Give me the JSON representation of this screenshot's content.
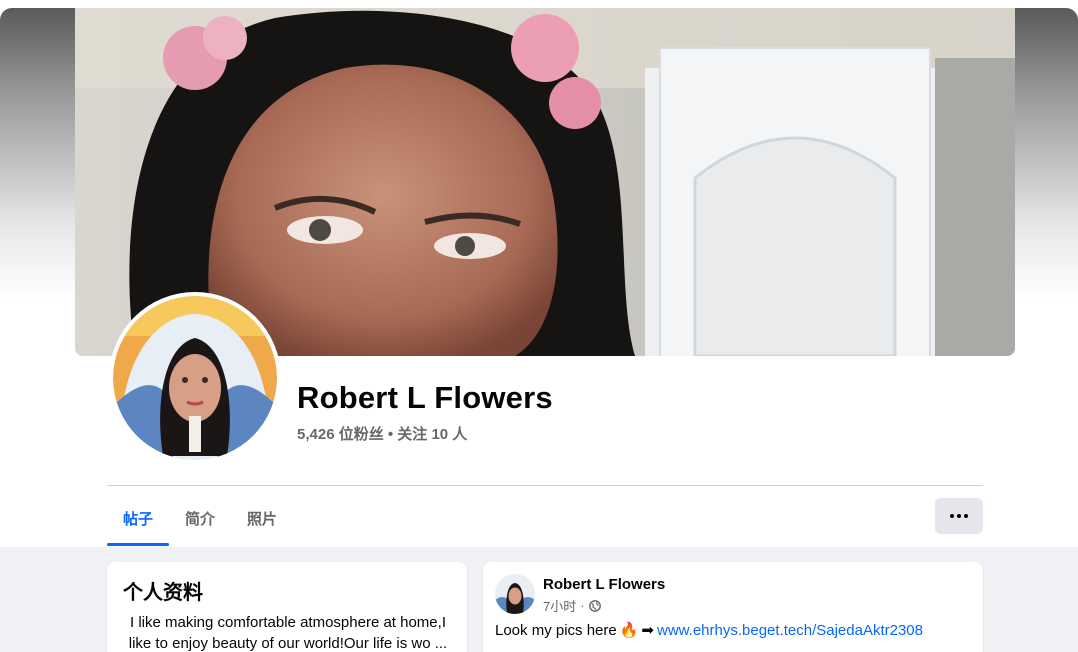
{
  "profile": {
    "name": "Robert L Flowers",
    "stats": "5,426 位粉丝 • 关注 10 人"
  },
  "tabs": [
    {
      "label": "帖子",
      "active": true
    },
    {
      "label": "简介",
      "active": false
    },
    {
      "label": "照片",
      "active": false
    }
  ],
  "more_button_icon": "more-horizontal-icon",
  "intro": {
    "title": "个人资料",
    "bio_line1": "I like making comfortable atmosphere at home,I",
    "bio_line2": "like to enjoy beauty of our world!Our life is wo ..."
  },
  "post": {
    "author": "Robert L Flowers",
    "time": "7小时",
    "separator": "·",
    "privacy_icon": "globe-icon",
    "text": "Look my pics here",
    "fire_emoji": "🔥",
    "arrow_emoji": "➡",
    "link": "www.ehrhys.beget.tech/SajedaAktr2308"
  },
  "colors": {
    "accent": "#0866ff",
    "secondary_text": "#65676b",
    "feed_background": "#f0f2f5"
  }
}
